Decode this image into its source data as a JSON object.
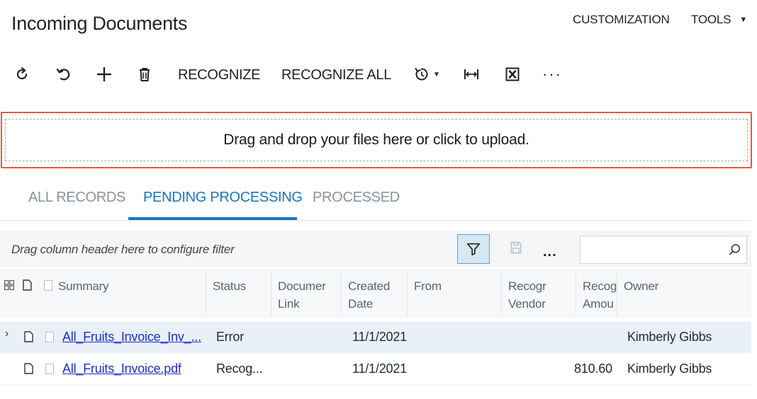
{
  "header": {
    "title": "Incoming Documents",
    "customization_label": "CUSTOMIZATION",
    "tools_label": "TOOLS"
  },
  "toolbar": {
    "recognize_label": "RECOGNIZE",
    "recognize_all_label": "RECOGNIZE ALL",
    "more_label": "···"
  },
  "upload": {
    "text": "Drag and drop your files here or click to upload."
  },
  "tabs": [
    {
      "label": "ALL RECORDS",
      "active": false
    },
    {
      "label": "PENDING PROCESSING",
      "active": true
    },
    {
      "label": "PROCESSED",
      "active": false
    }
  ],
  "filter": {
    "hint": "Drag column header here to configure filter",
    "more_label": "...",
    "search_value": ""
  },
  "grid": {
    "columns": {
      "summary": "Summary",
      "status": "Status",
      "document_link": [
        "Documer",
        "Link"
      ],
      "created_date": [
        "Created",
        "Date"
      ],
      "from": "From",
      "recognized_vendor": [
        "Recogr",
        "Vendor"
      ],
      "recognized_amount": [
        "Recog",
        "Amou"
      ],
      "owner": "Owner"
    },
    "rows": [
      {
        "summary": "All_Fruits_Invoice_Inv_...",
        "status": "Error",
        "created_date": "11/1/2021",
        "amount": "",
        "owner": "Kimberly Gibbs",
        "expandable": true
      },
      {
        "summary": "All_Fruits_Invoice.pdf",
        "status": "Recog...",
        "created_date": "11/1/2021",
        "amount": "810.60",
        "owner": "Kimberly Gibbs",
        "expandable": false
      }
    ]
  },
  "colors": {
    "accent": "#1577c4",
    "upload_border": "#e9573f",
    "link": "#1a2fcc"
  }
}
